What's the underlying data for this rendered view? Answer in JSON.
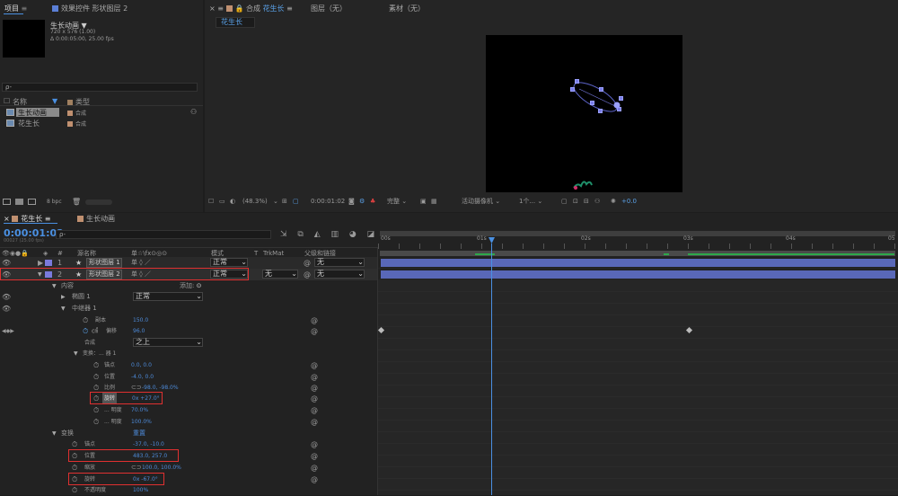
{
  "project_panel": {
    "tabs": [
      {
        "label": "项目"
      },
      {
        "label": "效果控件 形状图层 2"
      }
    ],
    "comp_name": "生长动画 ▼",
    "comp_info1": "720 x 576 (1.00)",
    "comp_info2": "Δ 0:00:05:00, 25.00 fps",
    "search_placeholder": "ρ-",
    "col_name": "名称",
    "col_type": "类型",
    "items": [
      {
        "name": "生长动画",
        "type": "合成",
        "selected": true
      },
      {
        "name": "花生长",
        "type": "合成",
        "selected": false
      }
    ],
    "bpc": "8 bpc"
  },
  "comp_panel": {
    "tab_label": "合成",
    "comp_tab": "花生长",
    "layer_tab": "图层（无）",
    "footage_tab": "素材（无）",
    "sub_tab": "花生长",
    "zoom": "(48.3%)",
    "timecode": "0:00:01:02",
    "resolution": "完整",
    "camera": "活动摄像机",
    "views": "1个...",
    "exposure": "+0.0"
  },
  "timeline": {
    "tabs": [
      {
        "label": "花生长"
      },
      {
        "label": "生长动画"
      }
    ],
    "timecode": "0:00:01:02",
    "frame_info": "00027 (25.00 fps)",
    "headers": {
      "num": "#",
      "source": "源名称",
      "switches": "单☆\\fx⊙◎⊙",
      "mode": "模式",
      "t": "T",
      "trkmat": "TrkMat",
      "parent": "父级和链接"
    },
    "layers": [
      {
        "num": "1",
        "name": "形状图层 1",
        "mode": "正常",
        "trkmat": "",
        "parent": "无"
      },
      {
        "num": "2",
        "name": "形状图层 2",
        "mode": "正常",
        "trkmat": "无",
        "parent": "无"
      }
    ],
    "props": {
      "content": "内容",
      "add": "添加:",
      "ellipse": "椭圆 1",
      "ellipse_mode": "正常",
      "repeater": "中继器 1",
      "copies": "副本",
      "copies_val": "150.0",
      "offset": "偏移",
      "offset_val": "96.0",
      "composite": "合成",
      "composite_val": "之上",
      "transform_rep": "变换：... 器 1",
      "anchor": "锚点",
      "anchor_val": "0.0, 0.0",
      "position": "位置",
      "position_val": "-4.0, 0.0",
      "scale": "比例",
      "scale_val": "-98.0, -98.0%",
      "rotation": "旋转",
      "rotation_val": "0x +27.0°",
      "start_opacity": "... 明度",
      "start_opacity_val": "70.0%",
      "end_opacity": "... 明度",
      "end_opacity_val": "100.0%",
      "transform": "变换",
      "reset": "重置",
      "t_anchor": "锚点",
      "t_anchor_val": "-37.0, -10.0",
      "t_position": "位置",
      "t_position_val": "483.0, 257.0",
      "t_scale": "缩放",
      "t_scale_val": "100.0, 100.0%",
      "t_rotation": "旋转",
      "t_rotation_val": "0x -67.0°",
      "t_opacity": "不透明度",
      "t_opacity_val": "100%"
    },
    "ruler": [
      "00s",
      "01s",
      "02s",
      "03s",
      "04s",
      "05"
    ]
  },
  "colors": {
    "accent": "#4a90e2",
    "layer_bar": "#5968b8",
    "label_purple": "#7a7adc",
    "highlight_red": "#e03030"
  }
}
